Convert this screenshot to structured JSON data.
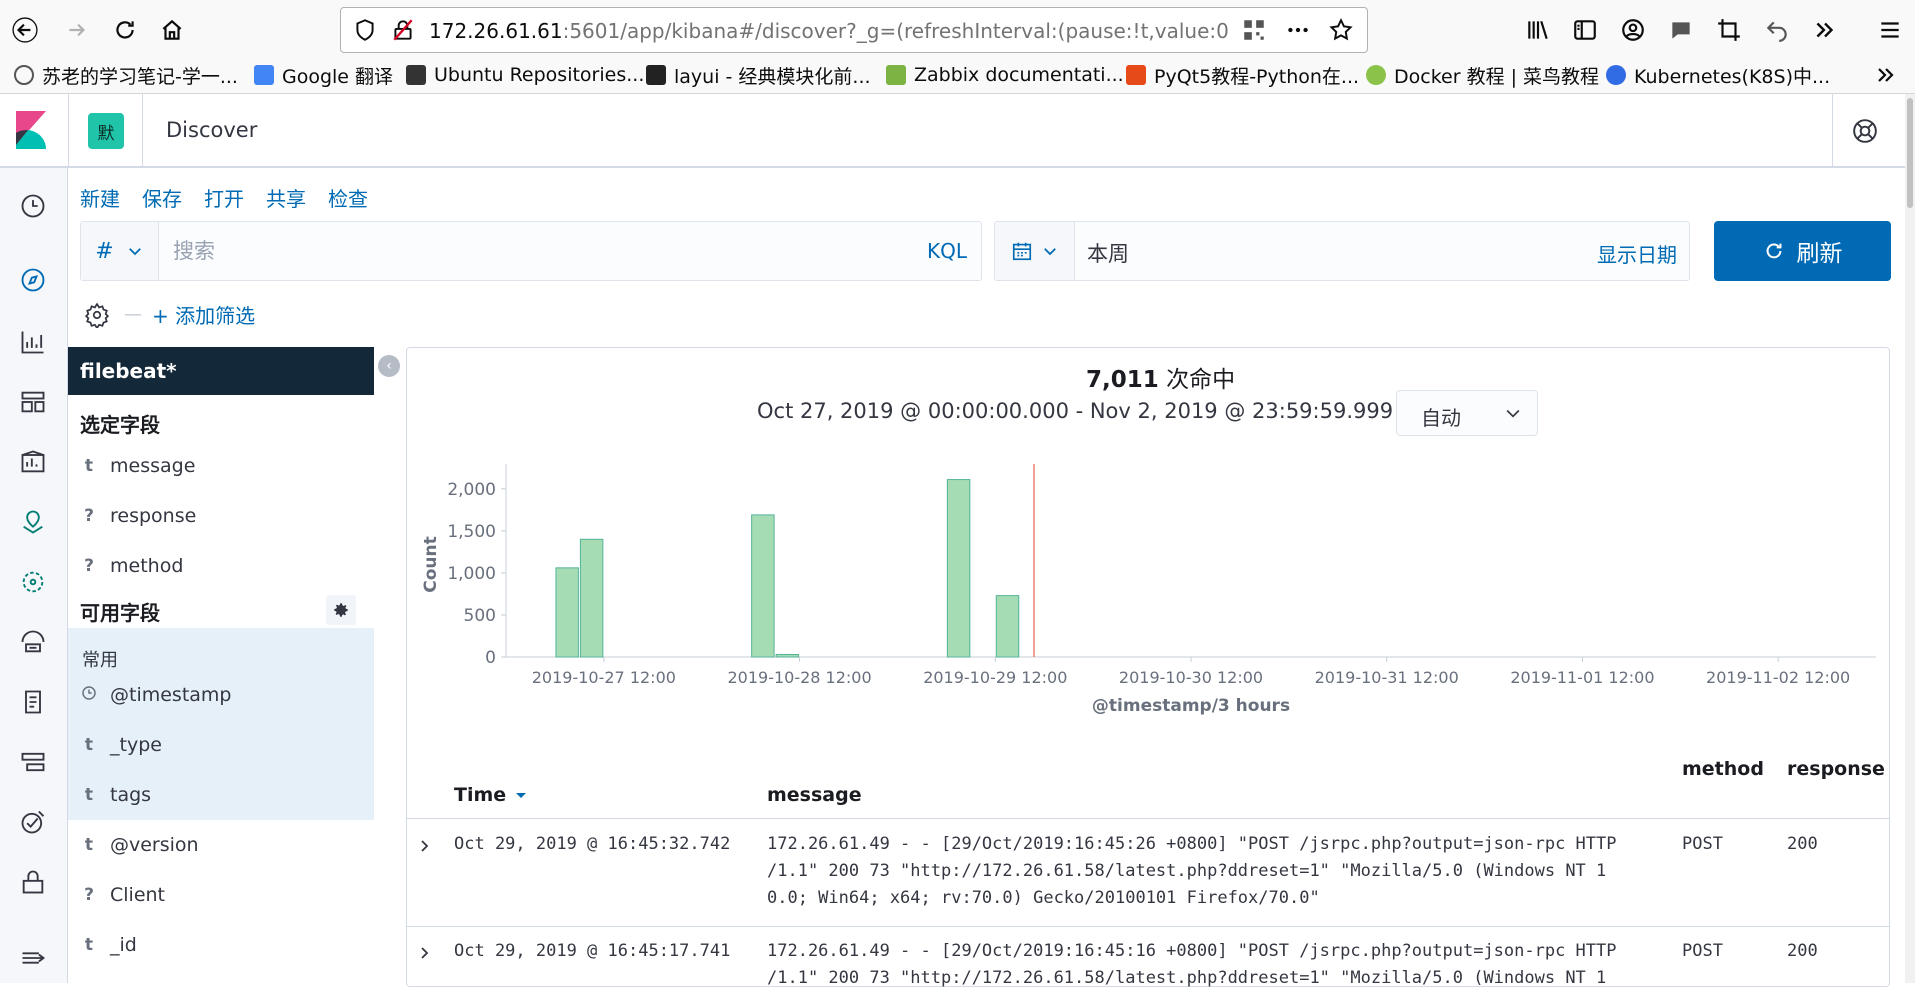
{
  "browser": {
    "url_host": "172.26.61.61",
    "url_rest": ":5601/app/kibana#/discover?_g=(refreshInterval:(pause:!t,value:0",
    "bookmarks": [
      {
        "label": "苏老的学习笔记-学一...",
        "icon_color": "#555555"
      },
      {
        "label": "Google 翻译",
        "icon_color": "#4285f4"
      },
      {
        "label": "Ubuntu Repositories...",
        "icon_color": "#333333"
      },
      {
        "label": "layui - 经典模块化前...",
        "icon_color": "#222222"
      },
      {
        "label": "Zabbix documentati...",
        "icon_color": "#7cb342"
      },
      {
        "label": "PyQt5教程-Python在...",
        "icon_color": "#e64a19"
      },
      {
        "label": "Docker 教程 | 菜鸟教程",
        "icon_color": "#8bc34a"
      },
      {
        "label": "Kubernetes(K8S)中...",
        "icon_color": "#326ce5"
      }
    ]
  },
  "header": {
    "space_initial": "默",
    "app_title": "Discover"
  },
  "top_menu": [
    "新建",
    "保存",
    "打开",
    "共享",
    "检查"
  ],
  "query": {
    "lang_symbol": "#",
    "placeholder": "搜索",
    "kql_label": "KQL"
  },
  "date": {
    "range": "本周",
    "show_dates": "显示日期",
    "refresh": "刷新"
  },
  "filters": {
    "add_label": "+ 添加筛选"
  },
  "sidebar": {
    "index_pattern": "filebeat*",
    "selected_title": "选定字段",
    "selected_fields": [
      {
        "type": "t",
        "name": "message"
      },
      {
        "type": "?",
        "name": "response"
      },
      {
        "type": "?",
        "name": "method"
      }
    ],
    "available_title": "可用字段",
    "common_label": "常用",
    "popular_fields": [
      {
        "type": "clock",
        "name": "@timestamp"
      },
      {
        "type": "t",
        "name": "_type"
      },
      {
        "type": "t",
        "name": "tags"
      }
    ],
    "other_fields": [
      {
        "type": "t",
        "name": "@version"
      },
      {
        "type": "?",
        "name": "Client"
      },
      {
        "type": "t",
        "name": "_id"
      }
    ]
  },
  "summary": {
    "hits_count": "7,011",
    "hits_label": "次命中",
    "time_range": "Oct 27, 2019 @ 00:00:00.000 - Nov 2, 2019 @ 23:59:59.999 —",
    "interval": "自动"
  },
  "chart_data": {
    "type": "bar",
    "xlabel": "@timestamp/3 hours",
    "ylabel": "Count",
    "ylim": [
      0,
      2200
    ],
    "yticks": [
      0,
      500,
      1000,
      1500,
      2000
    ],
    "ytick_labels": [
      "0",
      "500",
      "1,000",
      "1,500",
      "2,000"
    ],
    "xticks": [
      "2019-10-27 12:00",
      "2019-10-28 12:00",
      "2019-10-29 12:00",
      "2019-10-30 12:00",
      "2019-10-31 12:00",
      "2019-11-01 12:00",
      "2019-11-02 12:00"
    ],
    "bars": [
      {
        "start": "2019-10-27 06:00",
        "value": 1060
      },
      {
        "start": "2019-10-27 09:00",
        "value": 1400
      },
      {
        "start": "2019-10-28 06:00",
        "value": 1690
      },
      {
        "start": "2019-10-28 09:00",
        "value": 30
      },
      {
        "start": "2019-10-29 06:00",
        "value": 2110
      },
      {
        "start": "2019-10-29 12:00",
        "value": 730
      }
    ],
    "now_marker": "2019-10-29 16:45",
    "bar_color": "#a6dcb4",
    "bar_border": "#54b399",
    "now_color": "#e7664c"
  },
  "table": {
    "headers": {
      "time": "Time",
      "message": "message",
      "method": "method",
      "response": "response"
    },
    "rows": [
      {
        "time": "Oct 29, 2019 @ 16:45:32.742",
        "message": "172.26.61.49 - - [29/Oct/2019:16:45:26 +0800] \"POST /jsrpc.php?output=json-rpc HTTP\n/1.1\" 200 73 \"http://172.26.61.58/latest.php?ddreset=1\" \"Mozilla/5.0 (Windows NT 1\n0.0; Win64; x64; rv:70.0) Gecko/20100101 Firefox/70.0\"",
        "method": "POST",
        "response": "200"
      },
      {
        "time": "Oct 29, 2019 @ 16:45:17.741",
        "message": "172.26.61.49 - - [29/Oct/2019:16:45:16 +0800] \"POST /jsrpc.php?output=json-rpc HTTP\n/1.1\" 200 73 \"http://172.26.61.58/latest.php?ddreset=1\" \"Mozilla/5.0 (Windows NT 1",
        "method": "POST",
        "response": "200"
      }
    ]
  }
}
